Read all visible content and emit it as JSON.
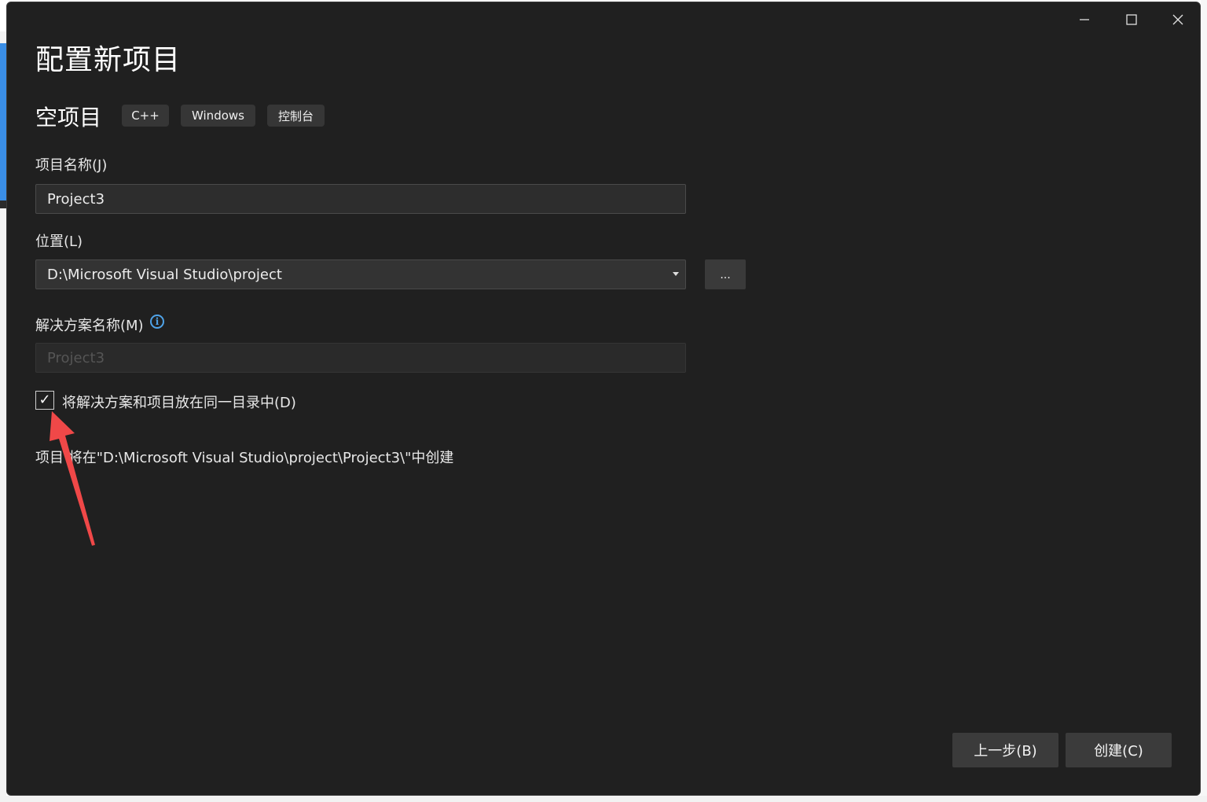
{
  "window": {
    "title": "配置新项目",
    "caption_buttons": {
      "minimize_icon": "minimize-icon",
      "maximize_icon": "maximize-icon",
      "close_icon": "close-icon"
    }
  },
  "template": {
    "name": "空项目",
    "tags": [
      "C++",
      "Windows",
      "控制台"
    ]
  },
  "form": {
    "project_name": {
      "label": "项目名称(J)",
      "value": "Project3"
    },
    "location": {
      "label": "位置(L)",
      "value": "D:\\Microsoft Visual Studio\\project",
      "browse_label": "..."
    },
    "solution_name": {
      "label": "解决方案名称(M)",
      "value": "Project3",
      "disabled": true
    },
    "same_directory": {
      "label": "将解决方案和项目放在同一目录中(D)",
      "checked": true,
      "check_glyph": "✓"
    },
    "path_note": "项目 将在\"D:\\Microsoft Visual Studio\\project\\Project3\\\"中创建"
  },
  "footer": {
    "back_label": "上一步(B)",
    "create_label": "创建(C)"
  },
  "colors": {
    "background": "#202020",
    "accent_info": "#4fa3e8",
    "annotation_arrow": "#f04848"
  }
}
